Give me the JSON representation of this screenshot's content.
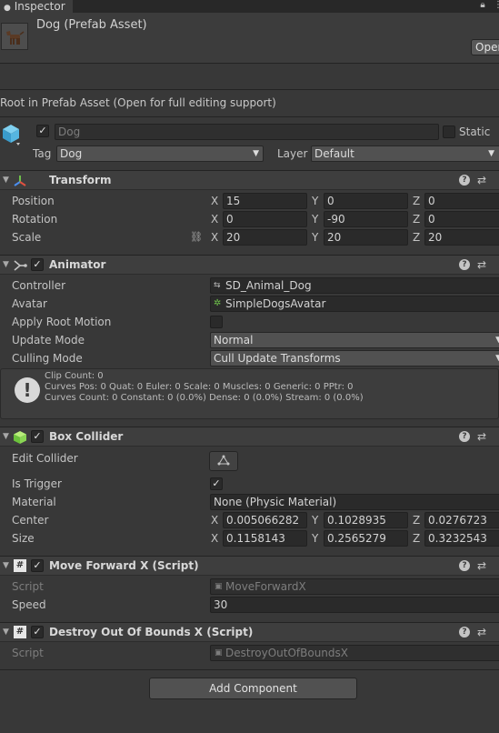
{
  "window": {
    "tab_label": "Inspector",
    "lock_icon": "lock-icon",
    "menu_icon": "kebab-menu-icon"
  },
  "asset": {
    "title": "Dog (Prefab Asset)",
    "open_button": "Open",
    "thumbnail_icon": "dog-thumbnail-icon"
  },
  "info_text": "Root in Prefab Asset (Open for full editing support)",
  "gameobject": {
    "active": true,
    "name": "Dog",
    "static_label": "Static",
    "static": false,
    "tag_label": "Tag",
    "tag_value": "Dog",
    "layer_label": "Layer",
    "layer_value": "Default",
    "icon": "cube-icon"
  },
  "transform": {
    "title": "Transform",
    "icon": "transform-axes-icon",
    "rows": [
      {
        "label": "Position",
        "x": "15",
        "y": "0",
        "z": "0"
      },
      {
        "label": "Rotation",
        "x": "0",
        "y": "-90",
        "z": "0"
      },
      {
        "label": "Scale",
        "x": "20",
        "y": "20",
        "z": "20"
      }
    ],
    "axis_x": "X",
    "axis_y": "Y",
    "axis_z": "Z",
    "constrain_icon": "link-icon"
  },
  "animator": {
    "title": "Animator",
    "icon": "animator-icon",
    "enabled": true,
    "controller_label": "Controller",
    "controller_value": "SD_Animal_Dog",
    "avatar_label": "Avatar",
    "avatar_value": "SimpleDogsAvatar",
    "apply_root_motion_label": "Apply Root Motion",
    "apply_root_motion": false,
    "update_mode_label": "Update Mode",
    "update_mode_value": "Normal",
    "culling_mode_label": "Culling Mode",
    "culling_mode_value": "Cull Update Transforms",
    "info_lines": [
      "Clip Count: 0",
      "Curves Pos: 0 Quat: 0 Euler: 0 Scale: 0 Muscles: 0 Generic: 0 PPtr: 0",
      "Curves Count: 0 Constant: 0 (0.0%) Dense: 0 (0.0%) Stream: 0 (0.0%)"
    ]
  },
  "box_collider": {
    "title": "Box Collider",
    "icon": "box-collider-icon",
    "enabled": true,
    "edit_collider_label": "Edit Collider",
    "edit_collider_icon": "edit-bounds-icon",
    "is_trigger_label": "Is Trigger",
    "is_trigger": true,
    "material_label": "Material",
    "material_value": "None (Physic Material)",
    "center_label": "Center",
    "center": {
      "x": "0.005066282",
      "y": "0.1028935",
      "z": "0.0276723"
    },
    "size_label": "Size",
    "size": {
      "x": "0.1158143",
      "y": "0.2565279",
      "z": "0.3232543"
    }
  },
  "move_forward": {
    "title": "Move Forward X (Script)",
    "icon": "script-icon",
    "enabled": true,
    "script_label": "Script",
    "script_value": "MoveForwardX",
    "speed_label": "Speed",
    "speed_value": "30"
  },
  "destroy_oob": {
    "title": "Destroy Out Of Bounds X (Script)",
    "icon": "script-icon",
    "enabled": true,
    "script_label": "Script",
    "script_value": "DestroyOutOfBoundsX"
  },
  "add_component_label": "Add Component",
  "header_icons": {
    "help": "?",
    "settings": "⇄"
  },
  "checkmark": "✓",
  "fold_arrow": "▼"
}
